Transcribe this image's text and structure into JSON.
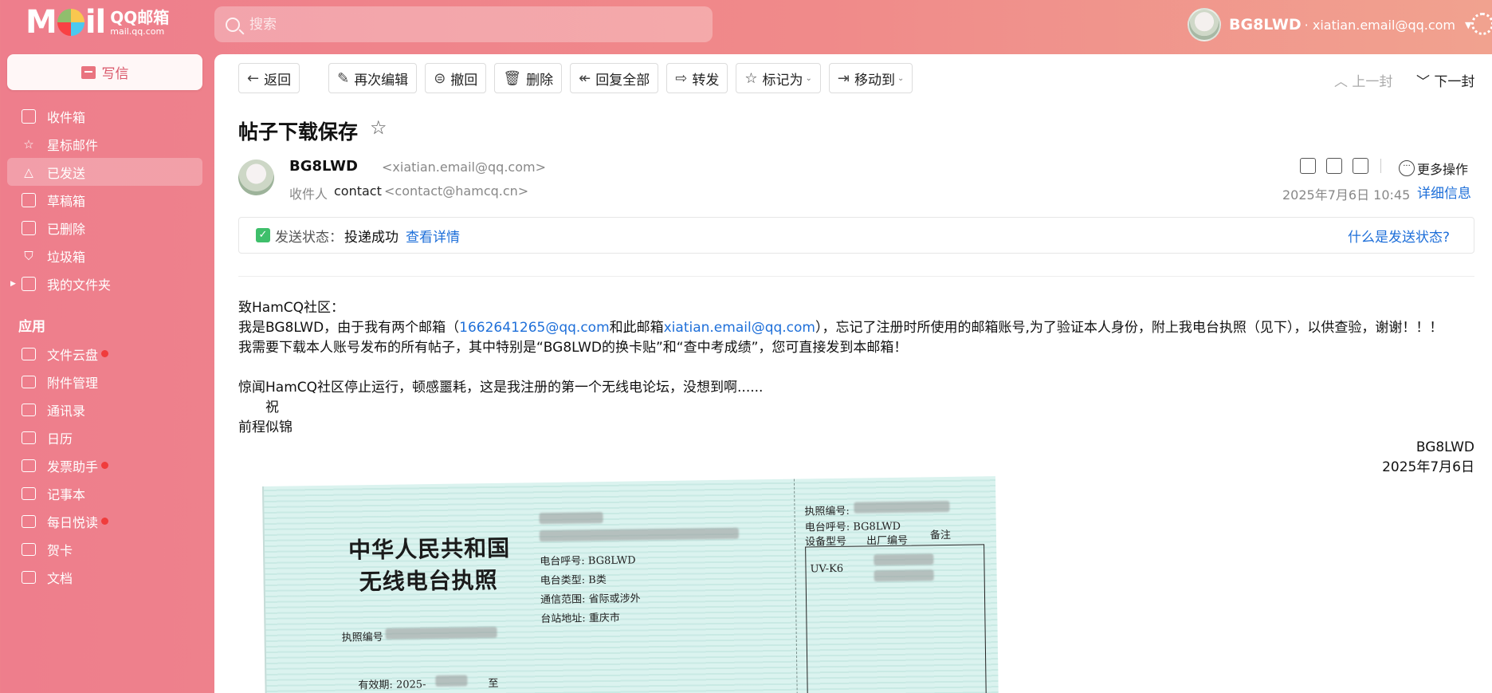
{
  "brand": {
    "logo_text": "QQ邮箱",
    "logo_sub": "mail.qq.com"
  },
  "search": {
    "placeholder": "搜索"
  },
  "account": {
    "name": "BG8LWD",
    "email": "· xiatian.email@qq.com"
  },
  "sidebar": {
    "compose_label": "写信",
    "items": [
      {
        "label": "收件箱",
        "icon": "inbox-icon"
      },
      {
        "label": "星标邮件",
        "icon": "star-icon"
      },
      {
        "label": "已发送",
        "icon": "sent-icon",
        "active": true
      },
      {
        "label": "草稿箱",
        "icon": "draft-icon"
      },
      {
        "label": "已删除",
        "icon": "trash-icon"
      },
      {
        "label": "垃圾箱",
        "icon": "spam-icon"
      },
      {
        "label": "我的文件夹",
        "icon": "folder-icon"
      }
    ],
    "apps_title": "应用",
    "apps": [
      {
        "label": "文件云盘",
        "badge": true
      },
      {
        "label": "附件管理",
        "badge": false
      },
      {
        "label": "通讯录",
        "badge": false
      },
      {
        "label": "日历",
        "badge": false
      },
      {
        "label": "发票助手",
        "badge": true
      },
      {
        "label": "记事本",
        "badge": false
      },
      {
        "label": "每日悦读",
        "badge": true
      },
      {
        "label": "贺卡",
        "badge": false
      },
      {
        "label": "文档",
        "badge": false
      }
    ]
  },
  "toolbar": {
    "back": "返回",
    "reedit": "再次编辑",
    "recall": "撤回",
    "delete": "删除",
    "reply_all": "回复全部",
    "forward": "转发",
    "mark_as": "标记为",
    "move_to": "移动到",
    "prev": "上一封",
    "next": "下一封"
  },
  "mail": {
    "subject": "帖子下载保存",
    "from_name": "BG8LWD",
    "from_email": "<xiatian.email@qq.com>",
    "to_label": "收件人",
    "to_name": "contact",
    "to_email": "<contact@hamcq.cn>",
    "more_ops": "更多操作",
    "date": "2025年7月6日 10:45",
    "details": "详细信息",
    "status_label": "发送状态：",
    "status_value": "投递成功",
    "status_link": "查看详情",
    "status_help": "什么是发送状态?"
  },
  "body": {
    "l1": "致HamCQ社区：",
    "l2a": "我是BG8LWD，由于我有两个邮箱（",
    "l2_link1": "1662641265@qq.com",
    "l2b": "和此邮箱",
    "l2_link2": "xiatian.email@qq.com",
    "l2c": "），忘记了注册时所使用的邮箱账号,为了验证本人身份，附上我电台执照（见下），以供查验，谢谢！！！",
    "l3": "我需要下载本人账号发布的所有帖子，其中特别是“BG8LWD的换卡贴”和“查中考成绩”，您可直接发到本邮箱！",
    "l4": "惊闻HamCQ社区停止运行，顿感噩耗，这是我注册的第一个无线电论坛，没想到啊......",
    "l5": "祝",
    "l6": "前程似锦",
    "sign": "BG8LWD",
    "sign_date": "2025年7月6日"
  },
  "license": {
    "title1": "中华人民共和国",
    "title2": "无线电台执照",
    "callsign_label": "电台呼号:",
    "callsign": "BG8LWD",
    "type_label": "电台类型:",
    "type": "B类",
    "range_label": "通信范围:",
    "range": "省际或涉外",
    "addr_label": "台站地址:",
    "addr": "重庆市",
    "license_no_label": "执照编号",
    "valid_label": "有效期:",
    "valid_year": "2025-",
    "to_label": "至",
    "r_license_no": "执照编号:",
    "r_callsign_label": "电台呼号:",
    "r_callsign": "BG8LWD",
    "model_label": "设备型号",
    "serial_label": "出厂编号",
    "note_label": "备注",
    "model": "UV-K6"
  }
}
